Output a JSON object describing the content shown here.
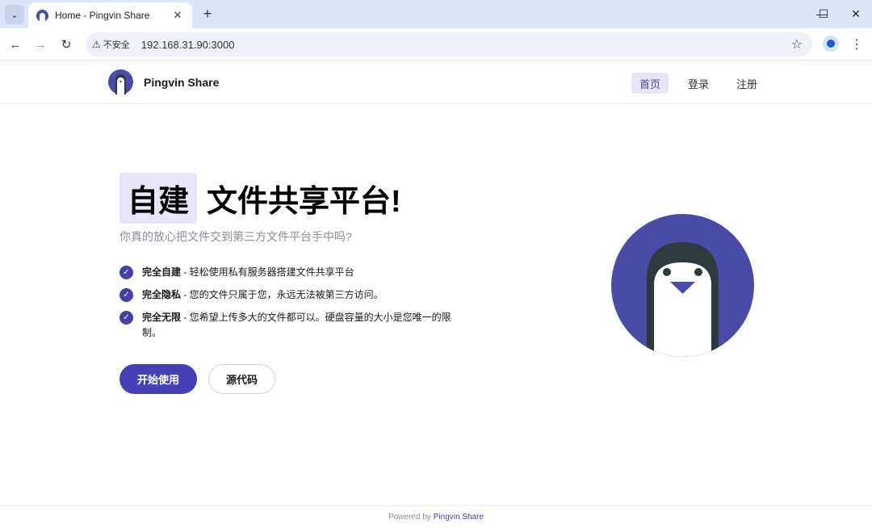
{
  "browser": {
    "tab_title": "Home - Pingvin Share",
    "tab_search_icon": "chevron-down-icon",
    "new_tab": "+",
    "security_label": "不安全",
    "url": "192.168.31.90:3000",
    "window_controls": {
      "minimize": "—",
      "maximize": "☐",
      "close": "✕"
    }
  },
  "header": {
    "brand": "Pingvin Share",
    "nav": [
      {
        "label": "首页",
        "active": true
      },
      {
        "label": "登录",
        "active": false
      },
      {
        "label": "注册",
        "active": false
      }
    ]
  },
  "hero": {
    "title_highlight": "自建",
    "title_rest": "文件共享平台!",
    "subtitle": "你真的放心把文件交到第三方文件平台手中吗?",
    "features": [
      {
        "bold": "完全自建",
        "text": " - 轻松使用私有服务器搭建文件共享平台"
      },
      {
        "bold": "完全隐私",
        "text": " - 您的文件只属于您，永远无法被第三方访问。"
      },
      {
        "bold": "完全无限",
        "text": " - 您希望上传多大的文件都可以。硬盘容量的大小是您唯一的限制。"
      }
    ],
    "primary_button": "开始使用",
    "secondary_button": "源代码"
  },
  "footer": {
    "prefix": "Powered by",
    "link": "Pingvin Share"
  },
  "colors": {
    "accent": "#4641b9",
    "highlight": "#e7e6f7",
    "mascot": "#4a4ba6"
  }
}
